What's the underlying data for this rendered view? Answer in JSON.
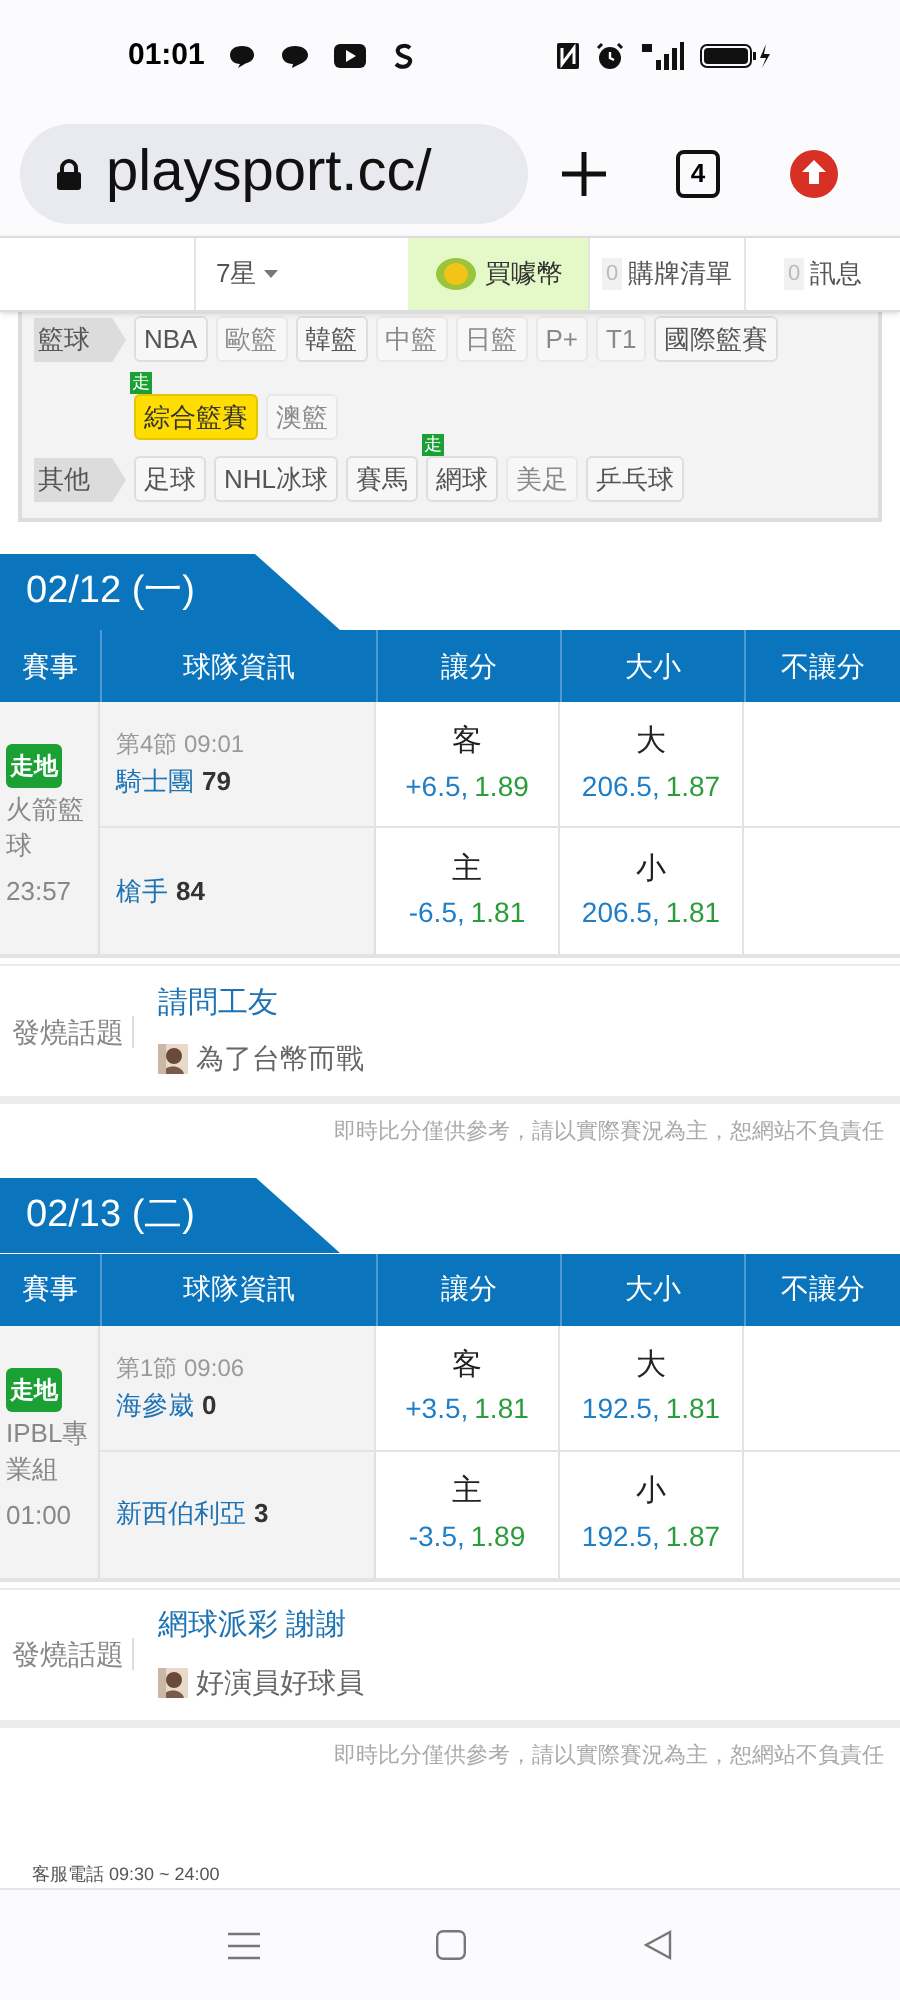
{
  "status_bar": {
    "time": "01:01"
  },
  "browser": {
    "url": "playsport.cc/",
    "tab_count": "4"
  },
  "nav": {
    "star": "7星",
    "buy": "買噱幣",
    "cart": {
      "count": "0",
      "label": "購牌清單"
    },
    "messages": {
      "count": "0",
      "label": "訊息"
    }
  },
  "categories": [
    {
      "label": "籃球",
      "items": [
        {
          "text": "NBA",
          "disabled": false,
          "selected": false
        },
        {
          "text": "歐籃",
          "disabled": true,
          "selected": false
        },
        {
          "text": "韓籃",
          "disabled": false,
          "selected": false
        },
        {
          "text": "中籃",
          "disabled": true,
          "selected": false
        },
        {
          "text": "日籃",
          "disabled": true,
          "selected": false
        },
        {
          "text": "P+",
          "disabled": true,
          "selected": false
        },
        {
          "text": "T1",
          "disabled": true,
          "selected": false
        },
        {
          "text": "國際籃賽",
          "disabled": false,
          "selected": false
        },
        {
          "text": "綜合籃賽",
          "disabled": false,
          "selected": true,
          "badge": "走"
        },
        {
          "text": "澳籃",
          "disabled": true,
          "selected": false
        }
      ]
    },
    {
      "label": "其他",
      "items": [
        {
          "text": "足球",
          "disabled": false,
          "selected": false
        },
        {
          "text": "NHL冰球",
          "disabled": false,
          "selected": false
        },
        {
          "text": "賽馬",
          "disabled": false,
          "selected": false
        },
        {
          "text": "網球",
          "disabled": false,
          "selected": false,
          "badge": "走"
        },
        {
          "text": "美足",
          "disabled": true,
          "selected": false
        },
        {
          "text": "乒乓球",
          "disabled": false,
          "selected": false
        }
      ]
    }
  ],
  "days": [
    {
      "date": "02/12 (一)",
      "columns": [
        "賽事",
        "球隊資訊",
        "讓分",
        "大小",
        "不讓分"
      ],
      "game": {
        "badge": "走地",
        "league": "火箭籃球",
        "time": "23:57",
        "period": "第4節 09:01",
        "teams": [
          {
            "name": "騎士團",
            "score": "79",
            "spread_side": "客",
            "spread_line": "+6.5,",
            "spread_odds": "1.89",
            "total_side": "大",
            "total_line": "206.5,",
            "total_odds": "1.87"
          },
          {
            "name": "槍手",
            "score": "84",
            "spread_side": "主",
            "spread_line": "-6.5,",
            "spread_odds": "1.81",
            "total_side": "小",
            "total_line": "206.5,",
            "total_odds": "1.81"
          }
        ]
      },
      "hot": {
        "label": "發燒話題",
        "title": "請問工友",
        "user": "為了台幣而戰"
      },
      "disclaimer": "即時比分僅供參考，請以實際賽況為主，恕網站不負責任"
    },
    {
      "date": "02/13 (二)",
      "columns": [
        "賽事",
        "球隊資訊",
        "讓分",
        "大小",
        "不讓分"
      ],
      "game": {
        "badge": "走地",
        "league": "IPBL專業組",
        "time": "01:00",
        "period": "第1節 09:06",
        "teams": [
          {
            "name": "海參崴",
            "score": "0",
            "spread_side": "客",
            "spread_line": "+3.5,",
            "spread_odds": "1.81",
            "total_side": "大",
            "total_line": "192.5,",
            "total_odds": "1.81"
          },
          {
            "name": "新西伯利亞",
            "score": "3",
            "spread_side": "主",
            "spread_line": "-3.5,",
            "spread_odds": "1.89",
            "total_side": "小",
            "total_line": "192.5,",
            "total_odds": "1.87"
          }
        ]
      },
      "hot": {
        "label": "發燒話題",
        "title": "網球派彩 謝謝",
        "user": "好演員好球員"
      },
      "disclaimer": "即時比分僅供參考，請以實際賽況為主，恕網站不負責任"
    }
  ],
  "footer": {
    "phone": "客服電話 09:30 ~ 24:00"
  }
}
